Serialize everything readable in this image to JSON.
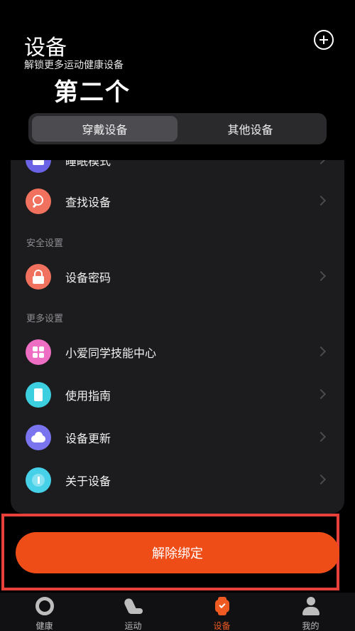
{
  "header": {
    "title": "设备",
    "subtitle": "解锁更多运动健康设备",
    "annotation": "第二个"
  },
  "tabs": [
    {
      "label": "穿戴设备",
      "active": true
    },
    {
      "label": "其他设备",
      "active": false
    }
  ],
  "list": {
    "partial_item": {
      "label": "睡眠模式",
      "icon": "moon-icon",
      "color": "#6b63e6"
    },
    "items_top": [
      {
        "label": "查找设备",
        "icon": "search-icon",
        "color": "#f0725e"
      }
    ],
    "section_security": {
      "title": "安全设置"
    },
    "items_security": [
      {
        "label": "设备密码",
        "icon": "lock-icon",
        "color": "#f0725e"
      }
    ],
    "section_more": {
      "title": "更多设置"
    },
    "items_more": [
      {
        "label": "小爱同学技能中心",
        "icon": "apps-icon",
        "color": "#ee6ec4"
      },
      {
        "label": "使用指南",
        "icon": "book-icon",
        "color": "#3ccfe0"
      },
      {
        "label": "设备更新",
        "icon": "cloud-upload-icon",
        "color": "#7a74ee"
      },
      {
        "label": "关于设备",
        "icon": "info-icon",
        "color": "#46d1e8"
      }
    ]
  },
  "unbind_button": {
    "label": "解除绑定",
    "color": "#ef4d18"
  },
  "bottom_nav": [
    {
      "label": "健康",
      "icon": "ring-icon",
      "active": false
    },
    {
      "label": "运动",
      "icon": "shoe-icon",
      "active": false
    },
    {
      "label": "设备",
      "icon": "watch-icon",
      "active": true
    },
    {
      "label": "我的",
      "icon": "person-icon",
      "active": false
    }
  ]
}
